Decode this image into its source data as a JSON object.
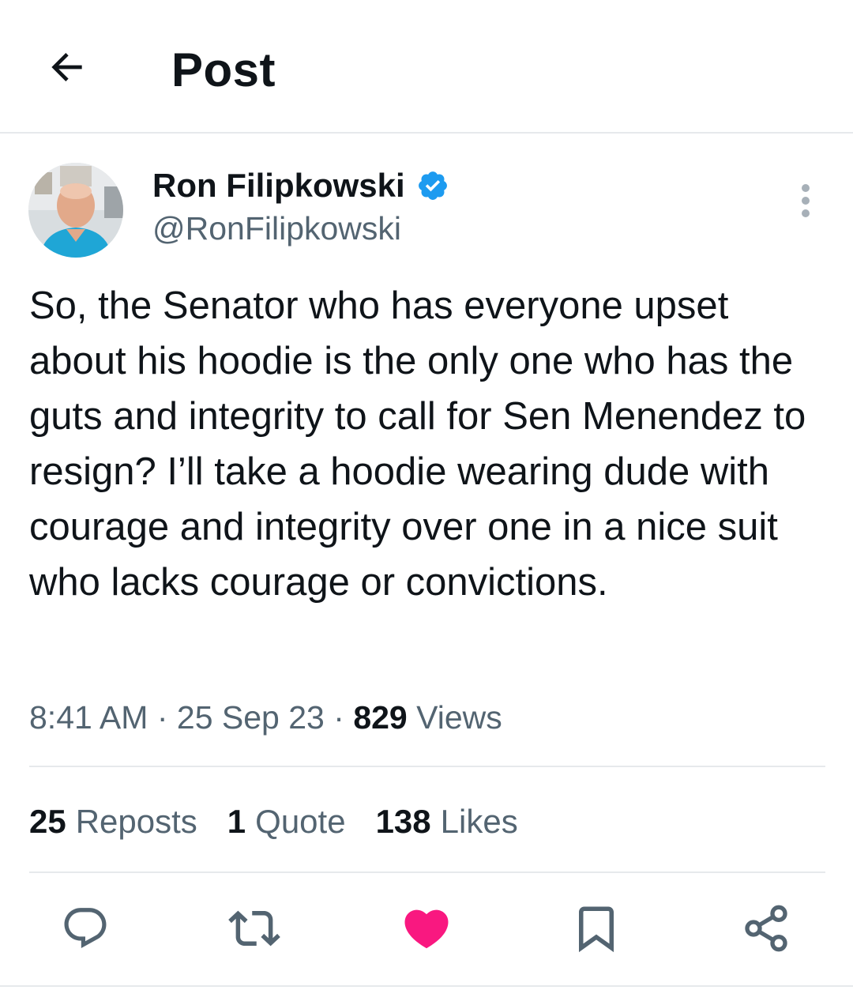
{
  "header": {
    "title": "Post",
    "back_icon": "arrow-left-icon"
  },
  "author": {
    "name": "Ron Filipkowski",
    "handle": "@RonFilipkowski",
    "verified": true,
    "verified_color": "#1d9bf0"
  },
  "tweet": {
    "text": "So, the Senator who has everyone upset about his hoodie is the only one who has the guts and integrity to call for Sen Menendez to resign? I’ll take a hoodie wearing dude with courage and integrity over one in a nice suit who lacks courage or convictions.",
    "time": "8:41 AM",
    "date": "25 Sep 23",
    "separator": "·",
    "views_count": "829",
    "views_label": "Views"
  },
  "stats": {
    "reposts_count": "25",
    "reposts_label": "Reposts",
    "quotes_count": "1",
    "quotes_label": "Quote",
    "likes_count": "138",
    "likes_label": "Likes"
  },
  "actions": {
    "icons": [
      "reply-icon",
      "repost-icon",
      "like-icon",
      "bookmark-icon",
      "share-icon"
    ],
    "liked": true,
    "like_color": "#f91880",
    "icon_color": "#536471"
  }
}
